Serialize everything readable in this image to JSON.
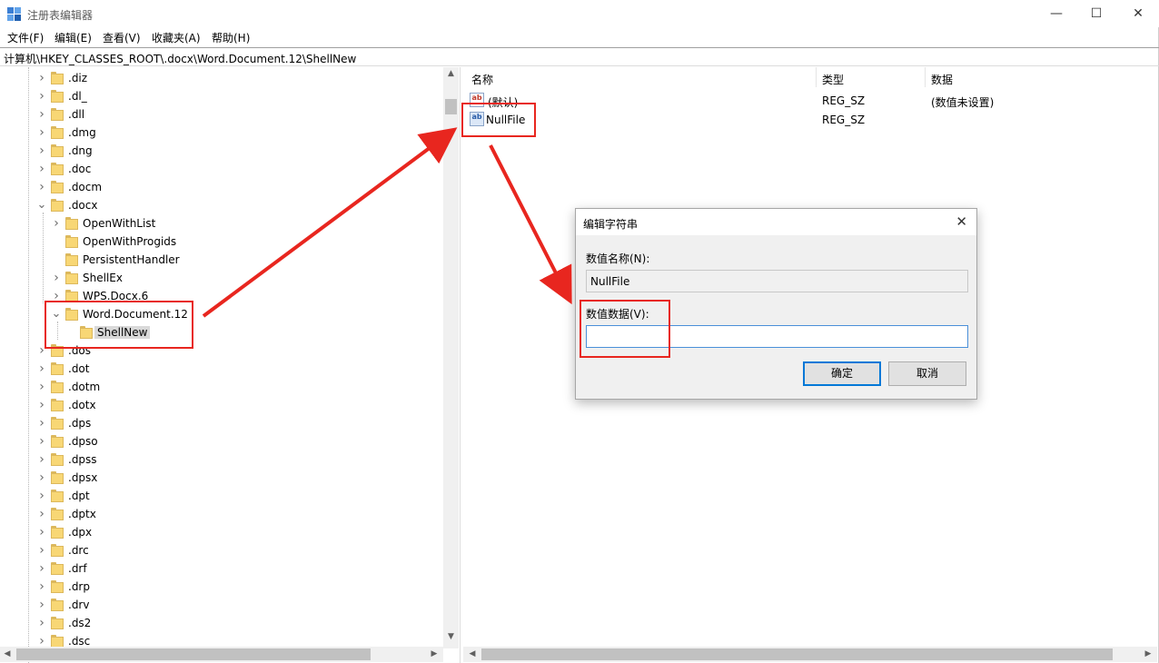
{
  "window": {
    "title": "注册表编辑器",
    "minimize": "—",
    "maximize": "☐",
    "close": "✕"
  },
  "menu": [
    "文件(F)",
    "编辑(E)",
    "查看(V)",
    "收藏夹(A)",
    "帮助(H)"
  ],
  "address": "计算机\\HKEY_CLASSES_ROOT\\.docx\\Word.Document.12\\ShellNew",
  "tree": [
    {
      "label": ".diz",
      "state": "collapsed"
    },
    {
      "label": ".dl_",
      "state": "collapsed"
    },
    {
      "label": ".dll",
      "state": "collapsed"
    },
    {
      "label": ".dmg",
      "state": "collapsed"
    },
    {
      "label": ".dng",
      "state": "collapsed"
    },
    {
      "label": ".doc",
      "state": "collapsed"
    },
    {
      "label": ".docm",
      "state": "collapsed"
    },
    {
      "label": ".docx",
      "state": "expanded"
    },
    {
      "label": "OpenWithList",
      "state": "collapsed"
    },
    {
      "label": "OpenWithProgids",
      "state": "leaf"
    },
    {
      "label": "PersistentHandler",
      "state": "leaf"
    },
    {
      "label": "ShellEx",
      "state": "collapsed"
    },
    {
      "label": "WPS.Docx.6",
      "state": "collapsed"
    },
    {
      "label": "Word.Document.12",
      "state": "expanded"
    },
    {
      "label": "ShellNew",
      "state": "selected"
    },
    {
      "label": ".dos",
      "state": "collapsed"
    },
    {
      "label": ".dot",
      "state": "collapsed"
    },
    {
      "label": ".dotm",
      "state": "collapsed"
    },
    {
      "label": ".dotx",
      "state": "collapsed"
    },
    {
      "label": ".dps",
      "state": "collapsed"
    },
    {
      "label": ".dpso",
      "state": "collapsed"
    },
    {
      "label": ".dpss",
      "state": "collapsed"
    },
    {
      "label": ".dpsx",
      "state": "collapsed"
    },
    {
      "label": ".dpt",
      "state": "collapsed"
    },
    {
      "label": ".dptx",
      "state": "collapsed"
    },
    {
      "label": ".dpx",
      "state": "collapsed"
    },
    {
      "label": ".drc",
      "state": "collapsed"
    },
    {
      "label": ".drf",
      "state": "collapsed"
    },
    {
      "label": ".drp",
      "state": "collapsed"
    },
    {
      "label": ".drv",
      "state": "collapsed"
    },
    {
      "label": ".ds2",
      "state": "collapsed"
    },
    {
      "label": ".dsc",
      "state": "collapsed"
    }
  ],
  "list": {
    "headers": {
      "name": "名称",
      "type": "类型",
      "data": "数据"
    },
    "rows": [
      {
        "name": "(默认)",
        "type": "REG_SZ",
        "data": "(数值未设置)"
      },
      {
        "name": "NullFile",
        "type": "REG_SZ",
        "data": ""
      }
    ]
  },
  "dialog": {
    "title": "编辑字符串",
    "close": "✕",
    "value_name_label": "数值名称(N):",
    "value_name": "NullFile",
    "value_data_label": "数值数据(V):",
    "value_data": "",
    "ok": "确定",
    "cancel": "取消"
  },
  "colors": {
    "annotation_red": "#e8261f",
    "folder_yellow": "#f8d775",
    "accent_blue": "#0078d7"
  }
}
